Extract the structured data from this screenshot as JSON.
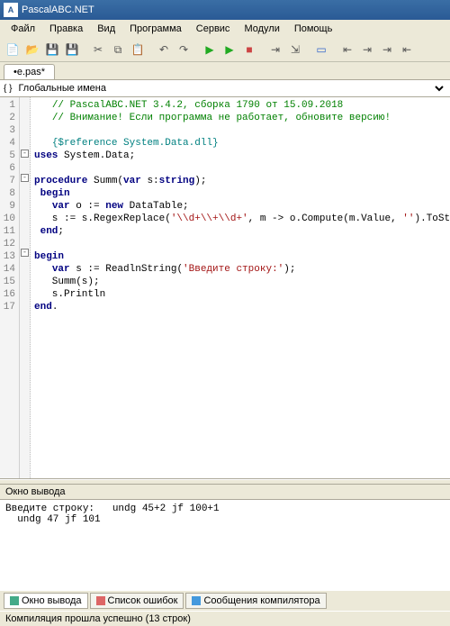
{
  "title": "PascalABC.NET",
  "menu": [
    "Файл",
    "Правка",
    "Вид",
    "Программа",
    "Сервис",
    "Модули",
    "Помощь"
  ],
  "tab": "•e.pas*",
  "name_dropdown": "Глобальные имена",
  "code_lines": [
    {
      "n": 1,
      "fold": "",
      "html": "   <span class='c-comment'>// PascalABC.NET 3.4.2, сборка 1790 от 15.09.2018</span>"
    },
    {
      "n": 2,
      "fold": "",
      "html": "   <span class='c-comment'>// Внимание! Если программа не работает, обновите версию!</span>"
    },
    {
      "n": 3,
      "fold": "",
      "html": ""
    },
    {
      "n": 4,
      "fold": "",
      "html": "   <span class='c-dir'>{$reference System.Data.dll}</span>"
    },
    {
      "n": 5,
      "fold": "[-]",
      "html": "<span class='c-kw'>uses</span> System.Data;"
    },
    {
      "n": 6,
      "fold": "",
      "html": ""
    },
    {
      "n": 7,
      "fold": "[-]",
      "html": "<span class='c-kw'>procedure</span> Summ(<span class='c-kw'>var</span> s:<span class='c-kw'>string</span>);"
    },
    {
      "n": 8,
      "fold": "",
      "html": " <span class='c-kw'>begin</span>"
    },
    {
      "n": 9,
      "fold": "",
      "html": "   <span class='c-kw'>var</span> o := <span class='c-kw'>new</span> DataTable;"
    },
    {
      "n": 10,
      "fold": "",
      "html": "   s := s.RegexReplace(<span class='c-str'>'\\\\d+\\\\+\\\\d+'</span>, m -> o.Compute(m.Value, <span class='c-str'>''</span>).ToString)"
    },
    {
      "n": 11,
      "fold": "",
      "html": " <span class='c-kw'>end</span>;"
    },
    {
      "n": 12,
      "fold": "",
      "html": ""
    },
    {
      "n": 13,
      "fold": "[-]",
      "html": "<span class='c-kw'>begin</span>"
    },
    {
      "n": 14,
      "fold": "",
      "html": "   <span class='c-kw'>var</span> s := ReadlnString(<span class='c-str'>'Введите строку:'</span>);"
    },
    {
      "n": 15,
      "fold": "",
      "html": "   Summ(s);"
    },
    {
      "n": 16,
      "fold": "",
      "html": "   s.Println"
    },
    {
      "n": 17,
      "fold": "",
      "html": "<span class='c-kw'>end</span>."
    }
  ],
  "output_title": "Окно вывода",
  "output_lines": [
    "Введите строку:   undg 45+2 jf 100+1",
    "  undg 47 jf 101"
  ],
  "bottom_tabs": [
    {
      "label": "Окно вывода",
      "active": true,
      "icon": "#4a8"
    },
    {
      "label": "Список ошибок",
      "active": false,
      "icon": "#d66"
    },
    {
      "label": "Сообщения компилятора",
      "active": false,
      "icon": "#49d"
    }
  ],
  "status": "Компиляция прошла успешно (13 строк)",
  "toolbar_icons": [
    {
      "name": "new-file-icon",
      "g": "📄"
    },
    {
      "name": "open-icon",
      "g": "📂"
    },
    {
      "name": "save-icon",
      "g": "💾"
    },
    {
      "name": "save-all-icon",
      "g": "💾"
    },
    {
      "sep": true
    },
    {
      "name": "cut-icon",
      "g": "✂"
    },
    {
      "name": "copy-icon",
      "g": "⧉"
    },
    {
      "name": "paste-icon",
      "g": "📋"
    },
    {
      "sep": true
    },
    {
      "name": "undo-icon",
      "g": "↶"
    },
    {
      "name": "redo-icon",
      "g": "↷"
    },
    {
      "sep": true
    },
    {
      "name": "run-icon",
      "g": "▶",
      "color": "#2a2"
    },
    {
      "name": "run-debug-icon",
      "g": "▶",
      "color": "#2a2"
    },
    {
      "name": "stop-icon",
      "g": "■",
      "color": "#c44"
    },
    {
      "sep": true
    },
    {
      "name": "step-into-icon",
      "g": "⇥"
    },
    {
      "name": "step-over-icon",
      "g": "⇲"
    },
    {
      "sep": true
    },
    {
      "name": "form-icon",
      "g": "▭",
      "color": "#36c"
    },
    {
      "sep": true
    },
    {
      "name": "nav-back-icon",
      "g": "⇤"
    },
    {
      "name": "nav-fwd-icon",
      "g": "⇥"
    },
    {
      "name": "indent-icon",
      "g": "⇥"
    },
    {
      "name": "outdent-icon",
      "g": "⇤"
    }
  ]
}
